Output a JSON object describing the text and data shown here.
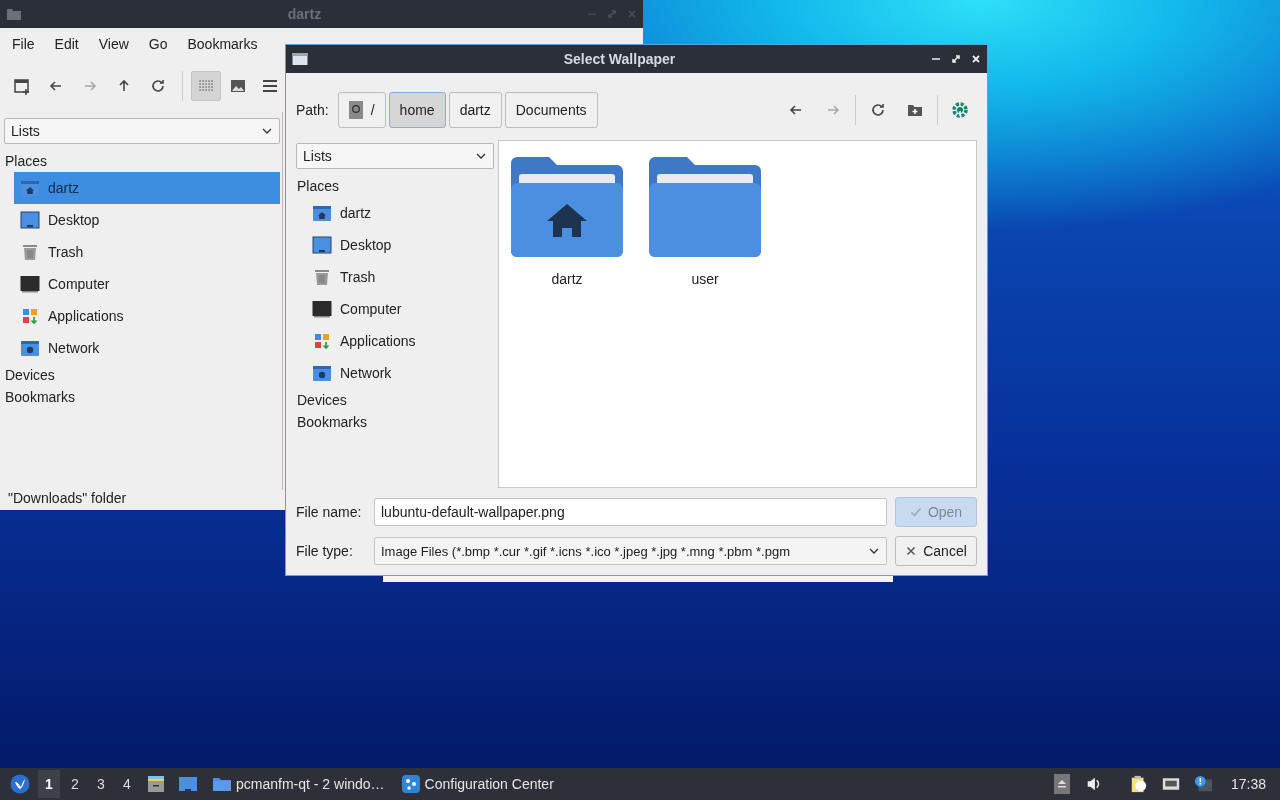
{
  "file_manager": {
    "title": "dartz",
    "menu": [
      "File",
      "Edit",
      "View",
      "Go",
      "Bookmarks"
    ],
    "toolbar": [
      {
        "kind": "new-tab",
        "disabled": false
      },
      {
        "kind": "back",
        "disabled": false
      },
      {
        "kind": "forward",
        "disabled": true
      },
      {
        "kind": "up",
        "disabled": false
      },
      {
        "kind": "reload",
        "disabled": false
      }
    ],
    "view_modes": [
      {
        "kind": "icons",
        "selected": true
      },
      {
        "kind": "thumbnails",
        "selected": false
      },
      {
        "kind": "list",
        "selected": false
      }
    ],
    "sidebar": {
      "dropdown": "Lists",
      "sections": [
        {
          "label": "Places",
          "items": [
            {
              "label": "dartz",
              "kind": "home",
              "selected": true
            },
            {
              "label": "Desktop",
              "kind": "desktop",
              "selected": false
            },
            {
              "label": "Trash",
              "kind": "trash",
              "selected": false
            },
            {
              "label": "Computer",
              "kind": "computer",
              "selected": false
            },
            {
              "label": "Applications",
              "kind": "applications",
              "selected": false
            },
            {
              "label": "Network",
              "kind": "network",
              "selected": false
            }
          ]
        },
        {
          "label": "Devices"
        },
        {
          "label": "Bookmarks"
        }
      ]
    },
    "status_bar": "\"Downloads\" folder"
  },
  "dialog": {
    "title": "Select Wallpaper",
    "path_label": "Path:",
    "path": [
      {
        "label": "/",
        "kind": "root",
        "selected": false
      },
      {
        "label": "home",
        "kind": "dir",
        "selected": true
      },
      {
        "label": "dartz",
        "kind": "dir",
        "selected": false
      },
      {
        "label": "Documents",
        "kind": "dir",
        "selected": false
      }
    ],
    "toolbar": [
      {
        "kind": "back",
        "disabled": false
      },
      {
        "kind": "forward",
        "disabled": true
      },
      {
        "kind": "reload",
        "disabled": false
      },
      {
        "kind": "new-folder",
        "disabled": false
      },
      {
        "kind": "settings",
        "disabled": false
      }
    ],
    "sidebar": {
      "dropdown": "Lists",
      "sections": [
        {
          "label": "Places",
          "items": [
            {
              "label": "dartz",
              "kind": "home",
              "selected": false
            },
            {
              "label": "Desktop",
              "kind": "desktop",
              "selected": false
            },
            {
              "label": "Trash",
              "kind": "trash",
              "selected": false
            },
            {
              "label": "Computer",
              "kind": "computer",
              "selected": false
            },
            {
              "label": "Applications",
              "kind": "applications",
              "selected": false
            },
            {
              "label": "Network",
              "kind": "network",
              "selected": false
            }
          ]
        },
        {
          "label": "Devices"
        },
        {
          "label": "Bookmarks"
        }
      ]
    },
    "files": [
      {
        "name": "dartz",
        "kind": "home"
      },
      {
        "name": "user",
        "kind": "folder"
      }
    ],
    "file_name": {
      "label": "File name:",
      "value": "lubuntu-default-wallpaper.png"
    },
    "file_type": {
      "label": "File type:",
      "value": "Image Files (*.bmp *.cur *.gif *.icns *.ico *.jpeg *.jpg *.mng *.pbm *.pgm"
    },
    "buttons": [
      {
        "label": "Open",
        "kind": "open",
        "disabled": true
      },
      {
        "label": "Cancel",
        "kind": "cancel",
        "disabled": false
      }
    ]
  },
  "taskbar": {
    "desktops": [
      {
        "label": "1",
        "selected": true
      },
      {
        "label": "2",
        "selected": false
      },
      {
        "label": "3",
        "selected": false
      },
      {
        "label": "4",
        "selected": false
      }
    ],
    "tasks": [
      {
        "label": "pcmanfm-qt - 2 windo…",
        "kind": "folder"
      },
      {
        "label": "Configuration Center",
        "kind": "config"
      }
    ],
    "clock": "17:38"
  }
}
